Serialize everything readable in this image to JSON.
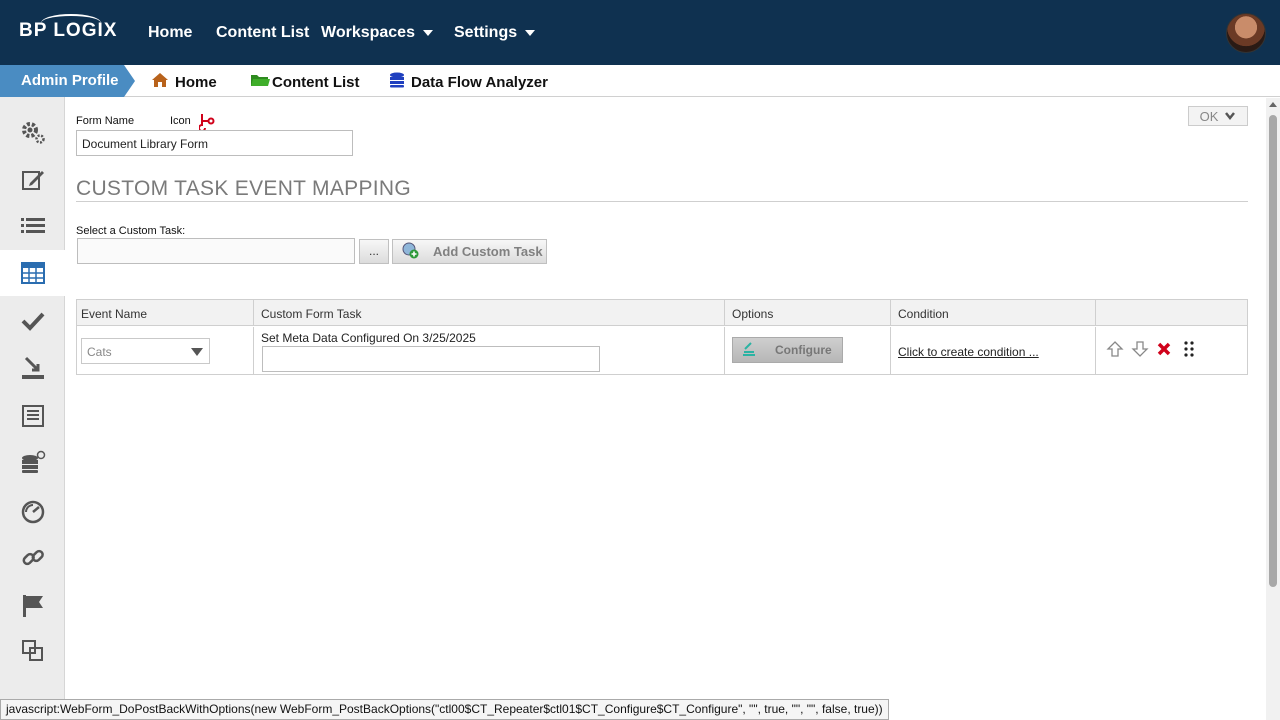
{
  "topnav": {
    "logo": "BP LOGIX",
    "items": [
      {
        "label": "Home"
      },
      {
        "label": "Content List"
      },
      {
        "label": "Workspaces"
      },
      {
        "label": "Settings"
      }
    ]
  },
  "breadcrumb": {
    "profile": "Admin Profile",
    "items": [
      {
        "label": "Home",
        "icon": "house-icon"
      },
      {
        "label": "Content List",
        "icon": "folder-icon"
      },
      {
        "label": "Data Flow Analyzer",
        "icon": "database-icon"
      }
    ]
  },
  "sidebar": {
    "items": [
      {
        "icon": "gears-icon"
      },
      {
        "icon": "edit-icon"
      },
      {
        "icon": "list-icon"
      },
      {
        "icon": "table-icon",
        "active": true
      },
      {
        "icon": "checkmark-icon"
      },
      {
        "icon": "download-icon"
      },
      {
        "icon": "form-list-icon"
      },
      {
        "icon": "database-add-icon"
      },
      {
        "icon": "timer-icon"
      },
      {
        "icon": "link-icon"
      },
      {
        "icon": "flag-icon"
      },
      {
        "icon": "clone-icon"
      }
    ]
  },
  "form": {
    "name_label": "Form Name",
    "icon_label": "Icon",
    "name_value": "Document Library Form",
    "ok_label": "OK",
    "section_title": "CUSTOM TASK EVENT MAPPING",
    "select_task_label": "Select a Custom Task:",
    "browse_label": "...",
    "add_task_label": "Add Custom Task"
  },
  "grid": {
    "headers": [
      "Event Name",
      "Custom Form Task",
      "Options",
      "Condition",
      ""
    ],
    "rows": [
      {
        "event": "Cats",
        "task_text": "Set Meta Data Configured On 3/25/2025",
        "task_value": "",
        "configure_label": "Configure",
        "condition_link": "Click to create condition ..."
      }
    ]
  },
  "status": {
    "text": "javascript:WebForm_DoPostBackWithOptions(new WebForm_PostBackOptions(\"ctl00$CT_Repeater$ctl01$CT_Configure$CT_Configure\", \"\", true, \"\", \"\", false, true))"
  },
  "colors": {
    "topbar": "#0f3150",
    "admin_tab": "#4a8cc2",
    "delete": "#d0021b"
  }
}
